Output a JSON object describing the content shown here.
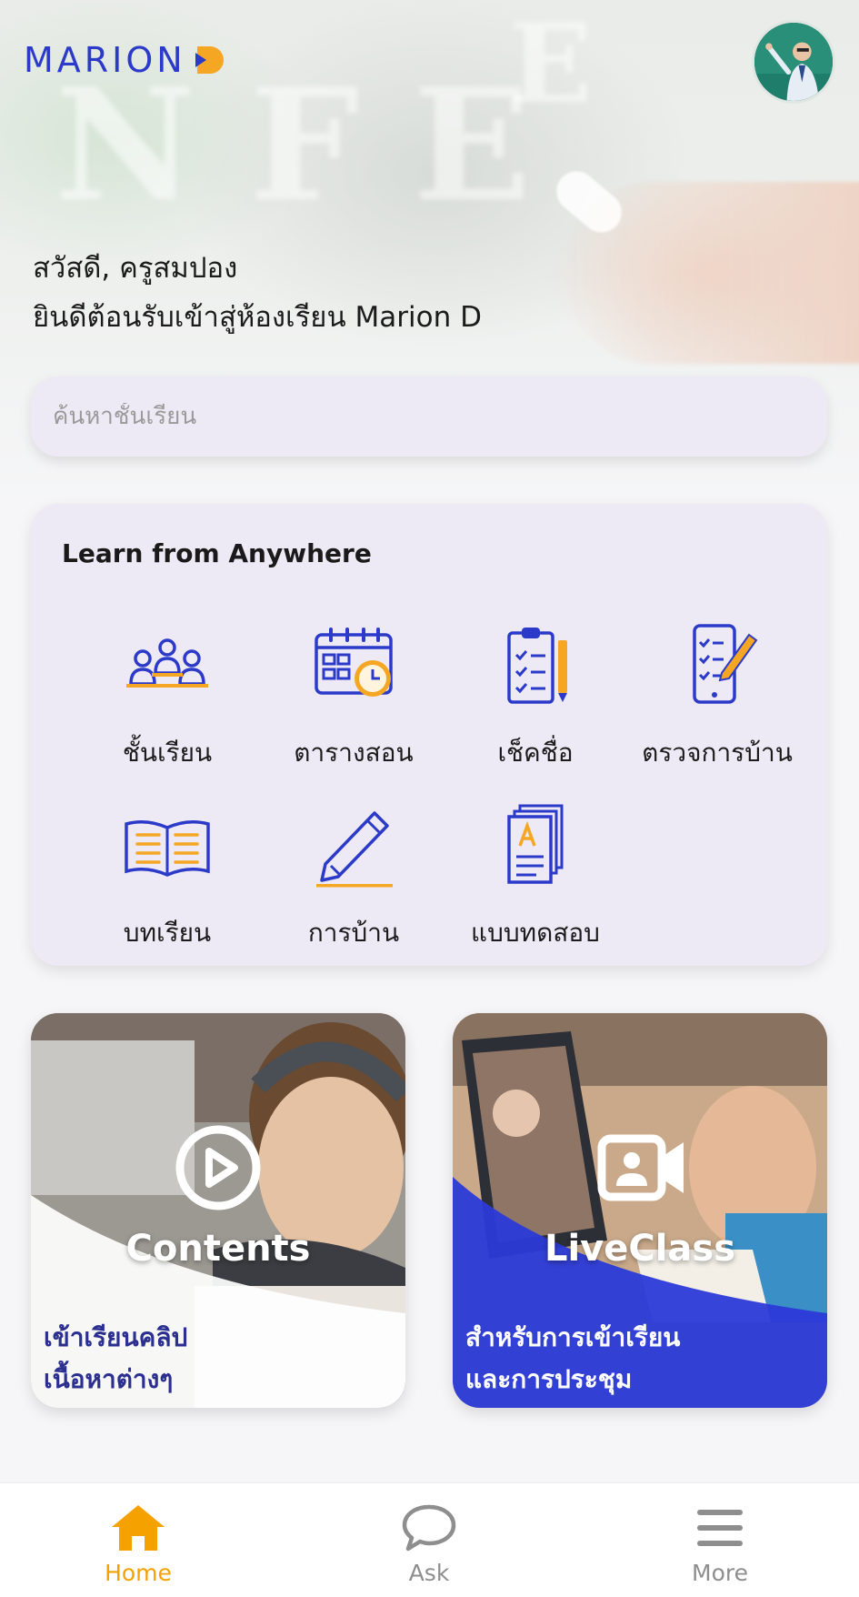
{
  "header": {
    "logo_text": "MARION",
    "brand_color": "#2c3ac9",
    "accent_color": "#f5a623"
  },
  "greeting": {
    "line1": "สวัสดี, ครูสมปอง",
    "line2": "ยินดีต้อนรับเข้าสู่ห้องเรียน Marion D"
  },
  "search": {
    "placeholder": "ค้นหาชั้นเรียน"
  },
  "card": {
    "title": "Learn from Anywhere",
    "items": [
      {
        "label": "ชั้นเรียน",
        "icon": "classroom-icon"
      },
      {
        "label": "ตารางสอน",
        "icon": "schedule-calendar-icon"
      },
      {
        "label": "เช็คชื่อ",
        "icon": "attendance-clipboard-icon"
      },
      {
        "label": "ตรวจการบ้าน",
        "icon": "check-homework-phone-icon"
      },
      {
        "label": "บทเรียน",
        "icon": "open-book-icon"
      },
      {
        "label": "การบ้าน",
        "icon": "pencil-icon"
      },
      {
        "label": "แบบทดสอบ",
        "icon": "test-paper-icon"
      }
    ]
  },
  "features": {
    "contents": {
      "title": "Contents",
      "sub1": "เข้าเรียนคลิป",
      "sub2": "เนื้อหาต่างๆ",
      "icon": "play-circle-icon"
    },
    "liveclass": {
      "title": "LiveClass",
      "sub1": "สำหรับการเข้าเรียน",
      "sub2": "และการประชุม",
      "icon": "video-camera-icon"
    }
  },
  "nav": {
    "home": "Home",
    "ask": "Ask",
    "more": "More",
    "active_color": "#f5a100",
    "inactive_color": "#8e8e8e"
  }
}
